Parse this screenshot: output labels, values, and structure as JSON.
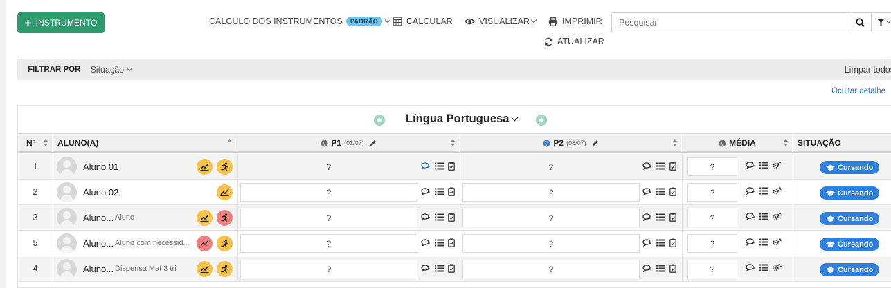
{
  "toolbar": {
    "add_button": "INSTRUMENTO",
    "calc_instruments": "CÁLCULO DOS INSTRUMENTOS",
    "calc_badge": "PADRÃO",
    "calculate": "CALCULAR",
    "view": "VISUALIZAR",
    "print": "IMPRIMIR",
    "update": "ATUALIZAR",
    "search_placeholder": "Pesquisar"
  },
  "filter": {
    "label": "FILTRAR POR",
    "situation": "Situação",
    "clear_all": "Limpar todos",
    "hide_details": "Ocultar detalhe"
  },
  "grid": {
    "subject": "Língua Portuguesa",
    "columns": {
      "num": "Nº",
      "student": "ALUNO(A)",
      "p1": "P1",
      "p1_date": "(01/07)",
      "p2": "P2",
      "p2_date": "(08/07)",
      "avg": "MÉDIA",
      "status": "SITUAÇÃO"
    },
    "rows": [
      {
        "num": "1",
        "name": "Aluno 01",
        "note": "",
        "p1": "?",
        "p2": "?",
        "avg": "?",
        "status": "Cursando"
      },
      {
        "num": "2",
        "name": "Aluno 02",
        "note": "",
        "p1": "?",
        "p2": "?",
        "avg": "?",
        "status": "Cursando"
      },
      {
        "num": "3",
        "name": "Aluno...",
        "note": "Aluno",
        "p1": "?",
        "p2": "?",
        "avg": "?",
        "status": "Cursando"
      },
      {
        "num": "5",
        "name": "Aluno...",
        "note": "Aluno com necessid...",
        "p1": "?",
        "p2": "?",
        "avg": "?",
        "status": "Cursando"
      },
      {
        "num": "4",
        "name": "Aluno...",
        "note": "Dispensa Mat 3 tri",
        "p1": "?",
        "p2": "?",
        "avg": "?",
        "status": "Cursando"
      }
    ]
  },
  "colors": {
    "primary_green": "#2f9a6c",
    "status_blue": "#2d7fe0",
    "badge_yellow": "#f7c24a",
    "badge_red": "#ef8080",
    "link_blue": "#2a7bd1"
  }
}
